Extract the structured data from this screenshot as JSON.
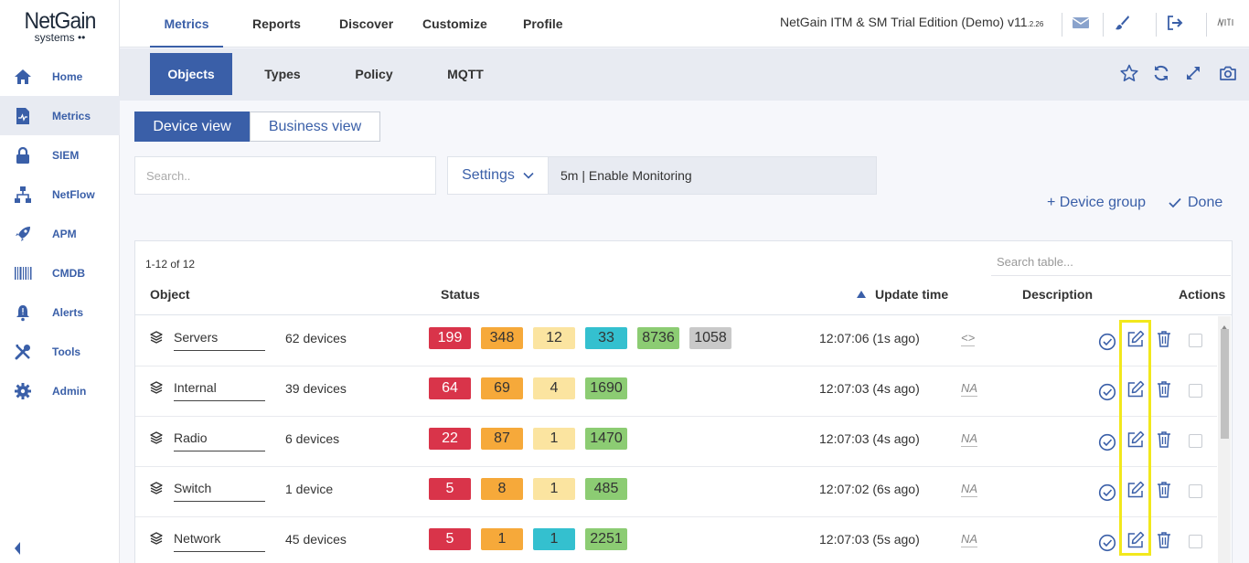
{
  "logo": {
    "main": "NetGain",
    "sub": "systems ••"
  },
  "sidebar": {
    "items": [
      {
        "label": "Home",
        "icon": "home-icon"
      },
      {
        "label": "Metrics",
        "icon": "metrics-icon",
        "active": true
      },
      {
        "label": "SIEM",
        "icon": "lock-icon"
      },
      {
        "label": "NetFlow",
        "icon": "network-icon"
      },
      {
        "label": "APM",
        "icon": "rocket-icon"
      },
      {
        "label": "CMDB",
        "icon": "barcode-icon"
      },
      {
        "label": "Alerts",
        "icon": "bell-icon"
      },
      {
        "label": "Tools",
        "icon": "tools-icon"
      },
      {
        "label": "Admin",
        "icon": "gear-icon"
      }
    ]
  },
  "topbar": {
    "tabs": [
      "Metrics",
      "Reports",
      "Discover",
      "Customize",
      "Profile"
    ],
    "edition": "NetGain ITM & SM Trial Edition (Demo) v11",
    "version_suffix": ".2.26"
  },
  "subtabs": [
    "Objects",
    "Types",
    "Policy",
    "MQTT"
  ],
  "views": {
    "device": "Device view",
    "business": "Business view"
  },
  "search": {
    "placeholder": "Search.."
  },
  "settings": {
    "label": "Settings",
    "value": "5m | Enable Monitoring"
  },
  "actions": {
    "device_group": "+ Device group",
    "done": "Done"
  },
  "table": {
    "count": "1-12 of 12",
    "search_placeholder": "Search table...",
    "headers": {
      "object": "Object",
      "status": "Status",
      "update": "Update time",
      "description": "Description",
      "actions": "Actions"
    },
    "rows": [
      {
        "name": "Servers",
        "devices": "62 devices",
        "badges": [
          {
            "v": "199",
            "c": "#d9344a",
            "t": "#fff"
          },
          {
            "v": "348",
            "c": "#f6a93a",
            "t": "#333"
          },
          {
            "v": "12",
            "c": "#fbe4a0",
            "t": "#333"
          },
          {
            "v": "33",
            "c": "#34c0cf",
            "t": "#333"
          },
          {
            "v": "8736",
            "c": "#8ccc73",
            "t": "#333"
          },
          {
            "v": "1058",
            "c": "#c9c9c9",
            "t": "#333"
          }
        ],
        "time": "12:07:06 (1s ago)",
        "desc": "<>"
      },
      {
        "name": "Internal",
        "devices": "39 devices",
        "badges": [
          {
            "v": "64",
            "c": "#d9344a",
            "t": "#fff"
          },
          {
            "v": "69",
            "c": "#f6a93a",
            "t": "#333"
          },
          {
            "v": "4",
            "c": "#fbe4a0",
            "t": "#333"
          },
          {
            "v": "1690",
            "c": "#8ccc73",
            "t": "#333"
          }
        ],
        "time": "12:07:03 (4s ago)",
        "desc": "NA"
      },
      {
        "name": "Radio",
        "devices": "6 devices",
        "badges": [
          {
            "v": "22",
            "c": "#d9344a",
            "t": "#fff"
          },
          {
            "v": "87",
            "c": "#f6a93a",
            "t": "#333"
          },
          {
            "v": "1",
            "c": "#fbe4a0",
            "t": "#333"
          },
          {
            "v": "1470",
            "c": "#8ccc73",
            "t": "#333"
          }
        ],
        "time": "12:07:03 (4s ago)",
        "desc": "NA"
      },
      {
        "name": "Switch",
        "devices": "1 device",
        "badges": [
          {
            "v": "5",
            "c": "#d9344a",
            "t": "#fff"
          },
          {
            "v": "8",
            "c": "#f6a93a",
            "t": "#333"
          },
          {
            "v": "1",
            "c": "#fbe4a0",
            "t": "#333"
          },
          {
            "v": "485",
            "c": "#8ccc73",
            "t": "#333"
          }
        ],
        "time": "12:07:02 (6s ago)",
        "desc": "NA"
      },
      {
        "name": "Network",
        "devices": "45 devices",
        "badges": [
          {
            "v": "5",
            "c": "#d9344a",
            "t": "#fff"
          },
          {
            "v": "1",
            "c": "#f6a93a",
            "t": "#333"
          },
          {
            "v": "1",
            "c": "#34c0cf",
            "t": "#333"
          },
          {
            "v": "2251",
            "c": "#8ccc73",
            "t": "#333"
          }
        ],
        "time": "12:07:03 (5s ago)",
        "desc": "NA"
      }
    ]
  },
  "colors": {
    "accent": "#3a5fa8",
    "highlight": "#f2e81c"
  }
}
